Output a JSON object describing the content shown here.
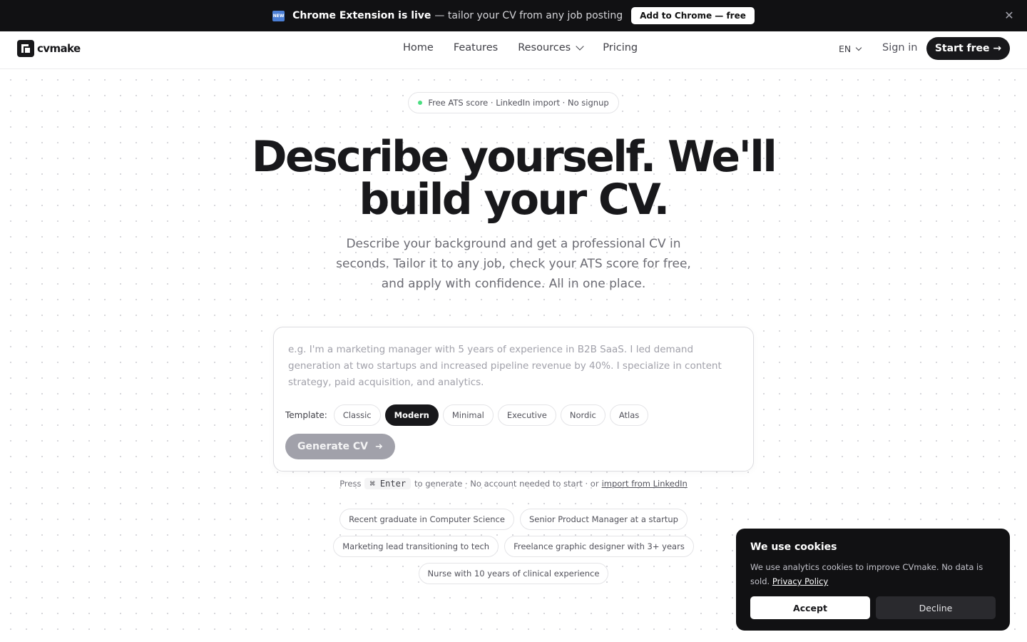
{
  "banner": {
    "badge": "NEW",
    "strong": "Chrome Extension is live",
    "rest": "— tailor your CV from any job posting",
    "cta": "Add to Chrome — free",
    "close": "✕"
  },
  "nav": {
    "logo_text": "cvmake",
    "links": [
      "Home",
      "Features",
      "Resources",
      "Pricing"
    ],
    "lang": "EN",
    "signin": "Sign in",
    "start": "Start free →"
  },
  "hero": {
    "pill": "Free ATS score · LinkedIn import · No signup",
    "headline_1": "Describe yourself. We'll",
    "headline_2": "build your CV.",
    "subtext": "Describe your background and get a professional CV in seconds. Tailor it to any job, check your ATS score for free, and apply with confidence. All in one place."
  },
  "composer": {
    "placeholder": "e.g. I'm a marketing manager with 5 years of experience in B2B SaaS. I led demand generation at two startups and increased pipeline revenue by 40%. I specialize in content strategy, paid acquisition, and analytics.",
    "template_label": "Template:",
    "templates": [
      "Classic",
      "Modern",
      "Minimal",
      "Executive",
      "Nordic",
      "Atlas"
    ],
    "selected_template": "Modern",
    "generate": "Generate CV"
  },
  "hint": {
    "press": "Press",
    "kbd": "⌘ Enter",
    "middle": "to generate · No account needed to start · or",
    "link": "import from LinkedIn"
  },
  "examples": [
    "Recent graduate in Computer Science",
    "Senior Product Manager at a startup",
    "Marketing lead transitioning to tech",
    "Freelance graphic designer with 3+ years",
    "Nurse with 10 years of clinical experience"
  ],
  "cookie": {
    "title": "We use cookies",
    "text": "We use analytics cookies to improve CVmake. No data is sold.",
    "link": "Privacy Policy",
    "accept": "Accept",
    "decline": "Decline"
  },
  "colors": {
    "dark": "#18181b",
    "banner_bg": "#111113",
    "status_dot": "#4ade80",
    "generate_disabled": "#a1a1aa"
  }
}
